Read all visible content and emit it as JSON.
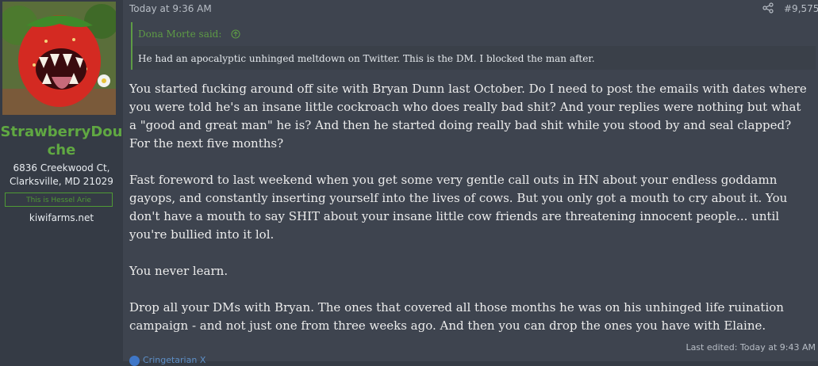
{
  "user": {
    "name_line1": "StrawberryDou",
    "name_line2": "che",
    "address_line1": "6836 Creekwood Ct,",
    "address_line2": "Clarksville, MD 21029",
    "banner": "This is Hessel Arie",
    "site": "kiwifarms.net"
  },
  "post": {
    "timestamp": "Today at 9:36 AM",
    "post_number": "#9,575",
    "quote_author": "Dona Morte said:",
    "quote_text": "He had an apocalyptic unhinged meltdown on Twitter. This is the DM. I blocked the man after.",
    "paragraphs": [
      "You started fucking around off site with Bryan Dunn last October. Do I need to post the emails with dates where you were told he's an insane little cockroach who does really bad shit? And your replies were nothing but what a \"good and great man\" he is? And then he started doing really bad shit while you stood by and seal clapped? For the next five months?",
      "Fast foreword to last weekend when you get some very gentle call outs in HN about your endless goddamn gayops, and constantly inserting yourself into the lives of cows. But you only got a mouth to cry about it. You don't have a mouth to say SHIT about your insane little cow friends are threatening innocent people... until you're bullied into it lol.",
      "You never learn.",
      "Drop all your DMs with Bryan. The ones that covered all those months he was on his unhinged life ruination campaign - and not just one from three weeks ago. And then you can drop the ones you have with Elaine."
    ],
    "edited": "Last edited: Today at 9:43 AM",
    "reaction_label": "Cringetarian X"
  },
  "icons": [
    "share-icon",
    "quote-jump-icon",
    "reaction-icon"
  ],
  "colors": {
    "username": "#60a842",
    "quote_border": "#5e9b45",
    "background": "#3e444f"
  }
}
